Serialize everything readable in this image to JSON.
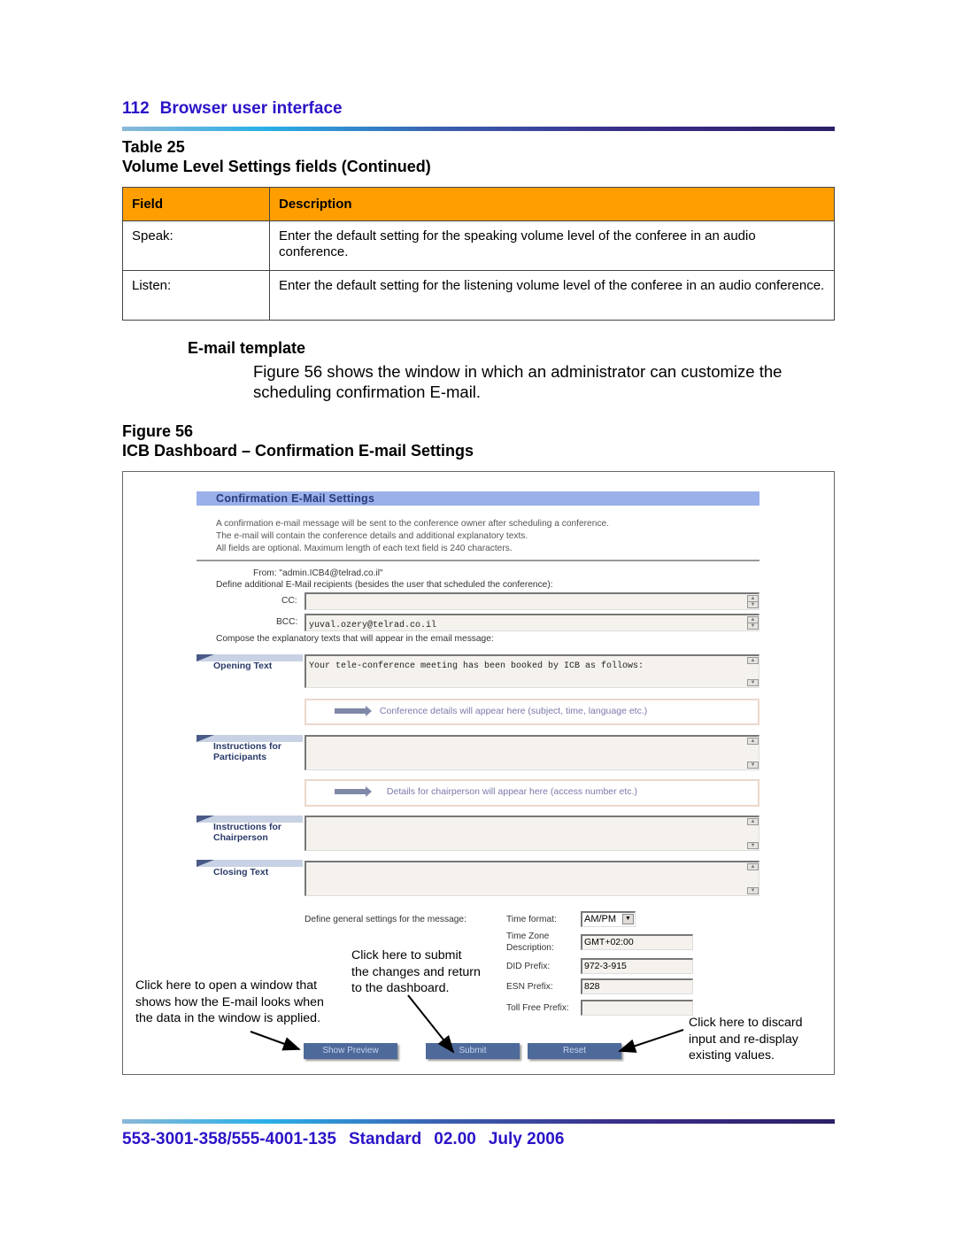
{
  "header": {
    "page_number": "112",
    "section": "Browser user interface"
  },
  "table": {
    "label": "Table 25",
    "title": "Volume Level Settings fields (Continued)",
    "columns": [
      "Field",
      "Description"
    ],
    "rows": [
      {
        "field": "Speak:",
        "description": "Enter the default setting for the speaking volume level of the conferee in an audio conference."
      },
      {
        "field": "Listen:",
        "description": "Enter the default setting for the listening volume level of the conferee in an audio conference."
      }
    ]
  },
  "section": {
    "heading": "E-mail template",
    "body": "Figure 56 shows the window in which an administrator can customize the scheduling confirmation E-mail."
  },
  "figure": {
    "label": "Figure 56",
    "title": "ICB Dashboard – Confirmation E-mail Settings",
    "ui": {
      "panel_title": "Confirmation E-Mail Settings",
      "intro_lines": [
        "A confirmation e-mail message will be sent to the conference owner after scheduling a conference.",
        "The e-mail will contain the conference details and additional explanatory texts.",
        "All fields are optional. Maximum length of each text field is 240 characters."
      ],
      "from_text": "From: \"admin.ICB4@telrad.co.il\"",
      "recipients_prompt": "Define additional E-Mail recipients (besides the user that scheduled the conference):",
      "cc_label": "CC:",
      "cc_value": "",
      "bcc_label": "BCC:",
      "bcc_value": "yuval.ozery@telrad.co.il",
      "compose_prompt": "Compose the explanatory texts that will appear in the email message:",
      "opening_label": "Opening Text",
      "opening_value": "Your tele-conference meeting has been booked by ICB as follows:",
      "conference_details_note": "Conference details will appear here (subject, time, language etc.)",
      "participants_label_1": "Instructions for",
      "participants_label_2": "Participants",
      "participants_value": "",
      "chairperson_note": "Details for chairperson will appear here (access number etc.)",
      "chairperson_label_1": "Instructions for",
      "chairperson_label_2": "Chairperson",
      "chairperson_value": "",
      "closing_label": "Closing Text",
      "closing_value": "",
      "general_prompt": "Define general settings for the message:",
      "time_format_label": "Time format:",
      "time_format_value": "AM/PM",
      "tz_label_1": "Time Zone",
      "tz_label_2": "Description:",
      "tz_value": "GMT+02:00",
      "did_label": "DID Prefix:",
      "did_value": "972-3-915",
      "esn_label": "ESN Prefix:",
      "esn_value": "828",
      "toll_label": "Toll Free Prefix:",
      "toll_value": "",
      "buttons": {
        "preview": "Show Preview",
        "submit": "Submit",
        "reset": "Reset"
      }
    },
    "callouts": {
      "preview": [
        "Click here to open a window that",
        "shows how the E-mail looks when",
        "the data in the window is applied."
      ],
      "submit": [
        "Click here to submit",
        "the changes and return",
        "to the dashboard."
      ],
      "reset": [
        "Click here to discard",
        "input and re-display",
        "existing values."
      ]
    }
  },
  "footer": {
    "doc_number": "553-3001-358/555-4001-135",
    "status": "Standard",
    "version": "02.00",
    "date": "July 2006"
  }
}
